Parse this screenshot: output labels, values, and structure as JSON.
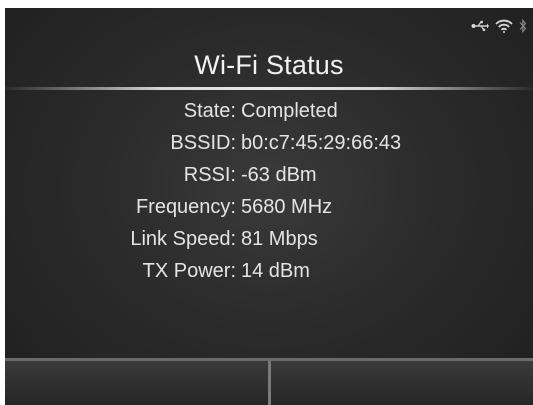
{
  "header": {
    "title": "Wi-Fi Status"
  },
  "status_bar": {
    "icons": [
      "usb-icon",
      "wifi-icon",
      "bluetooth-icon"
    ]
  },
  "wifi_status": {
    "rows": [
      {
        "label": "State:",
        "value": "Completed"
      },
      {
        "label": "BSSID:",
        "value": "b0:c7:45:29:66:43"
      },
      {
        "label": "RSSI:",
        "value": "-63 dBm"
      },
      {
        "label": "Frequency:",
        "value": "5680 MHz"
      },
      {
        "label": "Link Speed:",
        "value": "81 Mbps"
      },
      {
        "label": "TX Power:",
        "value": "14 dBm"
      }
    ]
  },
  "softkeys": {
    "left_label": "",
    "right_label": ""
  },
  "colors": {
    "screen_bg": "#2b2b2b",
    "text": "#e4e4e4",
    "rule": "#e8e8e8"
  }
}
